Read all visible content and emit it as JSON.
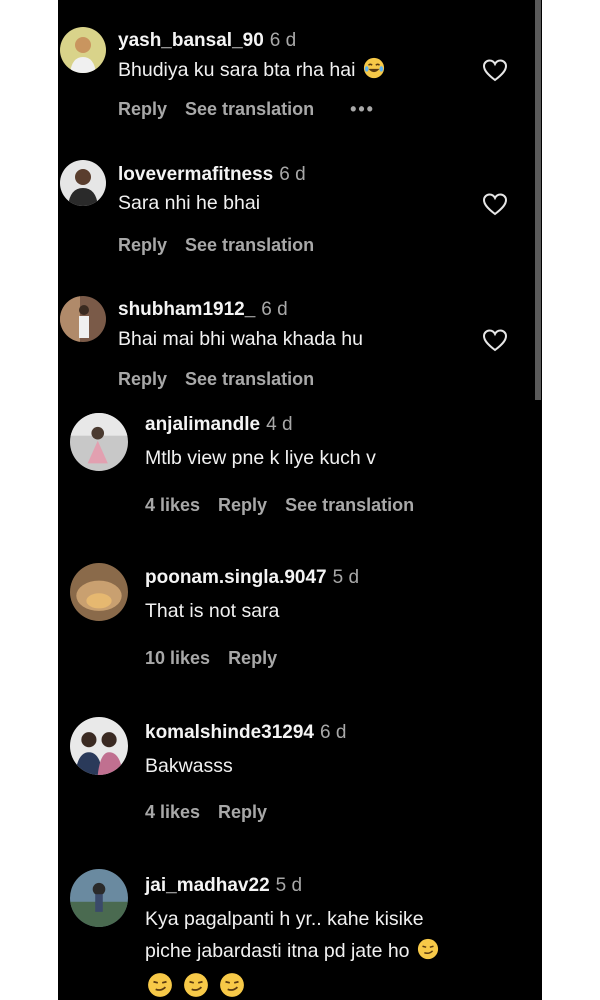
{
  "comments": [
    {
      "username": "yash_bansal_90",
      "time": "6 d",
      "text": "Bhudiya ku sara bta rha hai",
      "reply": "Reply",
      "translate": "See translation",
      "more": "•••"
    },
    {
      "username": "lovevermafitness",
      "time": "6 d",
      "text": "Sara nhi he bhai",
      "reply": "Reply",
      "translate": "See translation"
    },
    {
      "username": "shubham1912_",
      "time": "6 d",
      "text": "Bhai mai bhi waha khada hu",
      "reply": "Reply",
      "translate": "See translation"
    },
    {
      "username": "anjalimandle",
      "time": "4 d",
      "text": "Mtlb view pne k liye kuch v",
      "likes": "4 likes",
      "reply": "Reply",
      "translate": "See translation"
    },
    {
      "username": "poonam.singla.9047",
      "time": "5 d",
      "text": "That is not sara",
      "likes": "10 likes",
      "reply": "Reply"
    },
    {
      "username": "komalshinde31294",
      "time": "6 d",
      "text": "Bakwasss",
      "likes": "4 likes",
      "reply": "Reply"
    },
    {
      "username": "jai_madhav22",
      "time": "5 d",
      "text_line1": "Kya pagalpanti h yr.. kahe kisike",
      "text_line2": "piche jabardasti itna pd jate ho"
    }
  ],
  "icons": {
    "like": "heart-outline-icon",
    "laugh_emoji": "face-with-tears-of-joy",
    "smirk_emoji": "smirking-face"
  },
  "colors": {
    "background": "#000000",
    "primary_text": "#f2f2f2",
    "secondary_text": "#a8a8a8"
  }
}
